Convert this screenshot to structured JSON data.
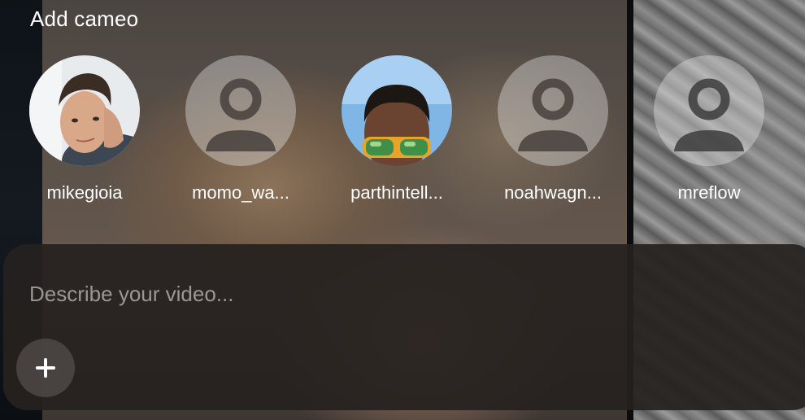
{
  "header": {
    "title": "Add cameo"
  },
  "cameos": [
    {
      "name": "mikegioia",
      "avatar": "photo"
    },
    {
      "name": "momo_wa...",
      "avatar": "person-placeholder-icon"
    },
    {
      "name": "parthintell...",
      "avatar": "photo"
    },
    {
      "name": "noahwagn...",
      "avatar": "person-placeholder-icon"
    },
    {
      "name": "mreflow",
      "avatar": "person-placeholder-icon"
    }
  ],
  "composer": {
    "placeholder": "Describe your video...",
    "value": "",
    "add_icon": "plus-icon"
  },
  "colors": {
    "text": "#ffffff",
    "composer_bg": "#26211f",
    "placeholder_avatar": "#e1e1e1"
  }
}
